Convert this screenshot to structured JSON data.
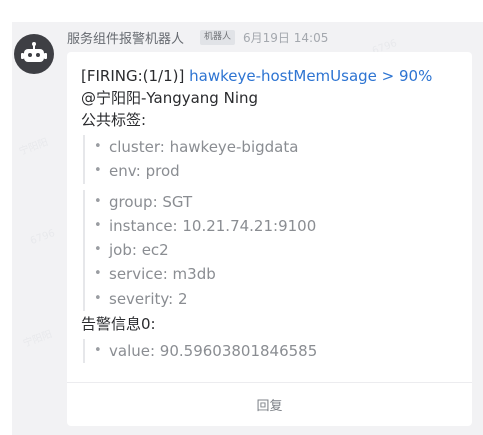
{
  "message": {
    "sender": "服务组件报警机器人",
    "badge": "机器人",
    "time": "6月19日 14:05",
    "title_prefix": "[FIRING:(1/1)] ",
    "title_link": "hawkeye-hostMemUsage > 90%",
    "mention": "@宁阳阳-Yangyang Ning",
    "common_labels_heading": "公共标签:",
    "common_labels_group1": [
      "cluster: hawkeye-bigdata",
      "env: prod"
    ],
    "common_labels_group2": [
      "group: SGT",
      "instance: 10.21.74.21:9100",
      "job: ec2",
      "service: m3db",
      "severity: 2"
    ],
    "alarm_heading": "告警信息0:",
    "alarm_values": [
      "value: 90.59603801846585"
    ],
    "reply_label": "回复"
  },
  "watermarks": [
    "宁阳阳",
    "6796",
    "宁阳阳",
    "6796",
    "宁阳阳",
    "6796"
  ],
  "colors": {
    "link": "#2d74d2",
    "avatar": "#3e3f44",
    "background": "#f2f2f4"
  },
  "icons": {
    "avatar": "robot-icon"
  }
}
